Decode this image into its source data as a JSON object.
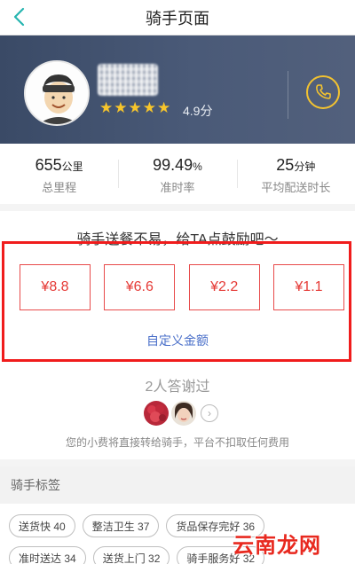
{
  "header": {
    "title": "骑手页面"
  },
  "rider": {
    "stars": "★★★★★",
    "rating": "4.9分"
  },
  "stats": [
    {
      "value": "655",
      "unit": "公里",
      "label": "总里程"
    },
    {
      "value": "99.49",
      "unit": "%",
      "label": "准时率"
    },
    {
      "value": "25",
      "unit": "分钟",
      "label": "平均配送时长"
    }
  ],
  "tip": {
    "title": "骑手送餐不易，给TA点鼓励吧～",
    "amounts": [
      "¥8.8",
      "¥6.6",
      "¥2.2",
      "¥1.1"
    ],
    "custom_label": "自定义金额",
    "thanks_count": "2人答谢过",
    "note": "您的小费将直接转给骑手，平台不扣取任何费用"
  },
  "tags_section": {
    "title": "骑手标签",
    "tags": [
      "送货快 40",
      "整洁卫生 37",
      "货品保存完好 36",
      "准时送达 34",
      "送货上门 32",
      "骑手服务好 32"
    ]
  },
  "watermark": {
    "text": "云南龙网"
  },
  "colors": {
    "accent_yellow": "#f2c230",
    "highlight_red": "#f01c1c",
    "link_blue": "#4a6fc9",
    "hero_bg": "#3a4a66"
  }
}
